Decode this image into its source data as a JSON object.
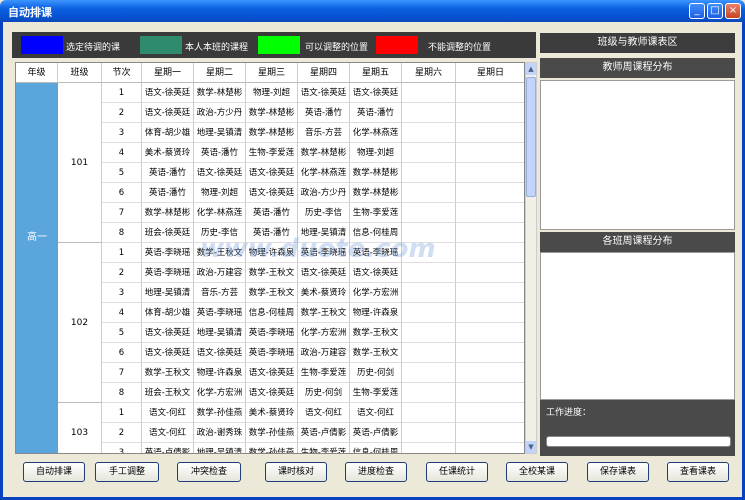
{
  "window": {
    "title": "自动排课"
  },
  "legend": [
    {
      "label": "选定待调的课",
      "color": "#0000ff"
    },
    {
      "label": "本人本班的课程",
      "color": "#2e8b6e"
    },
    {
      "label": "可以调整的位置",
      "color": "#00ff00"
    },
    {
      "label": "不能调整的位置",
      "color": "#ff0000"
    }
  ],
  "grid": {
    "headers": [
      "年级",
      "班级",
      "节次",
      "星期一",
      "星期二",
      "星期三",
      "星期四",
      "星期五",
      "星期六",
      "星期日"
    ],
    "grade": "高一",
    "classes": [
      {
        "name": "101",
        "rows": [
          [
            "1",
            "语文-徐英廷",
            "数学-林楚彬",
            "物理-刘超",
            "语文-徐英廷",
            "语文-徐英廷"
          ],
          [
            "2",
            "语文-徐英廷",
            "政治-方少丹",
            "数学-林楚彬",
            "英语-潘竹",
            "英语-潘竹"
          ],
          [
            "3",
            "体育-胡少雄",
            "地理-吴镇清",
            "数学-林楚彬",
            "音乐-方芸",
            "化学-林燕莲"
          ],
          [
            "4",
            "美术-蔡贤玲",
            "英语-潘竹",
            "生物-李爱莲",
            "数学-林楚彬",
            "物理-刘超"
          ],
          [
            "5",
            "英语-潘竹",
            "语文-徐英廷",
            "语文-徐英廷",
            "化学-林燕莲",
            "数学-林楚彬"
          ],
          [
            "6",
            "英语-潘竹",
            "物理-刘超",
            "语文-徐英廷",
            "政治-方少丹",
            "数学-林楚彬"
          ],
          [
            "7",
            "数学-林楚彬",
            "化学-林燕莲",
            "英语-潘竹",
            "历史-李信",
            "生物-李爱莲"
          ],
          [
            "8",
            "班会-徐英廷",
            "历史-李信",
            "英语-潘竹",
            "地理-吴镇清",
            "信息-何桂周"
          ]
        ]
      },
      {
        "name": "102",
        "rows": [
          [
            "1",
            "英语-李晓瑶",
            "数学-王秋文",
            "物理-许森泉",
            "英语-李晓瑶",
            "英语-李晓瑶"
          ],
          [
            "2",
            "英语-李晓瑶",
            "政治-万建容",
            "数学-王秋文",
            "语文-徐英廷",
            "语文-徐英廷"
          ],
          [
            "3",
            "地理-吴镇清",
            "音乐-方芸",
            "数学-王秋文",
            "美术-蔡贤玲",
            "化学-方宏洲"
          ],
          [
            "4",
            "体育-胡少雄",
            "英语-李晓瑶",
            "信息-何桂周",
            "数学-王秋文",
            "物理-许森泉"
          ],
          [
            "5",
            "语文-徐英廷",
            "地理-吴镇清",
            "英语-李晓瑶",
            "化学-方宏洲",
            "数学-王秋文"
          ],
          [
            "6",
            "语文-徐英廷",
            "语文-徐英廷",
            "英语-李晓瑶",
            "政治-万建容",
            "数学-王秋文"
          ],
          [
            "7",
            "数学-王秋文",
            "物理-许森泉",
            "语文-徐英廷",
            "生物-李爱莲",
            "历史-何剑"
          ],
          [
            "8",
            "班会-王秋文",
            "化学-方宏洲",
            "语文-徐英廷",
            "历史-何剑",
            "生物-李爱莲"
          ]
        ]
      },
      {
        "name": "103",
        "rows": [
          [
            "1",
            "语文-何红",
            "数学-孙佳燕",
            "美术-蔡贤玲",
            "语文-何红",
            "语文-何红"
          ],
          [
            "2",
            "语文-何红",
            "政治-谢秀珠",
            "数学-孙佳燕",
            "英语-卢倩影",
            "英语-卢倩影"
          ],
          [
            "3",
            "英语-卢倩影",
            "地理-吴镇清",
            "数学-孙佳燕",
            "生物-李爱莲",
            "信息-何桂周"
          ]
        ]
      }
    ]
  },
  "right_panel": {
    "top_title": "班级与教师课表区",
    "teacher_title": "教师周课程分布",
    "class_title": "各班周课程分布",
    "progress_label": "工作进度："
  },
  "buttons": [
    {
      "label": "自动排课"
    },
    {
      "label": "手工调整"
    },
    {
      "label": "冲突检查"
    },
    {
      "label": "课时核对"
    },
    {
      "label": "进度检查"
    },
    {
      "label": "任课统计"
    },
    {
      "label": "全校某课"
    },
    {
      "label": "保存课表"
    },
    {
      "label": "查看课表"
    }
  ],
  "watermark": "www.duote.com"
}
